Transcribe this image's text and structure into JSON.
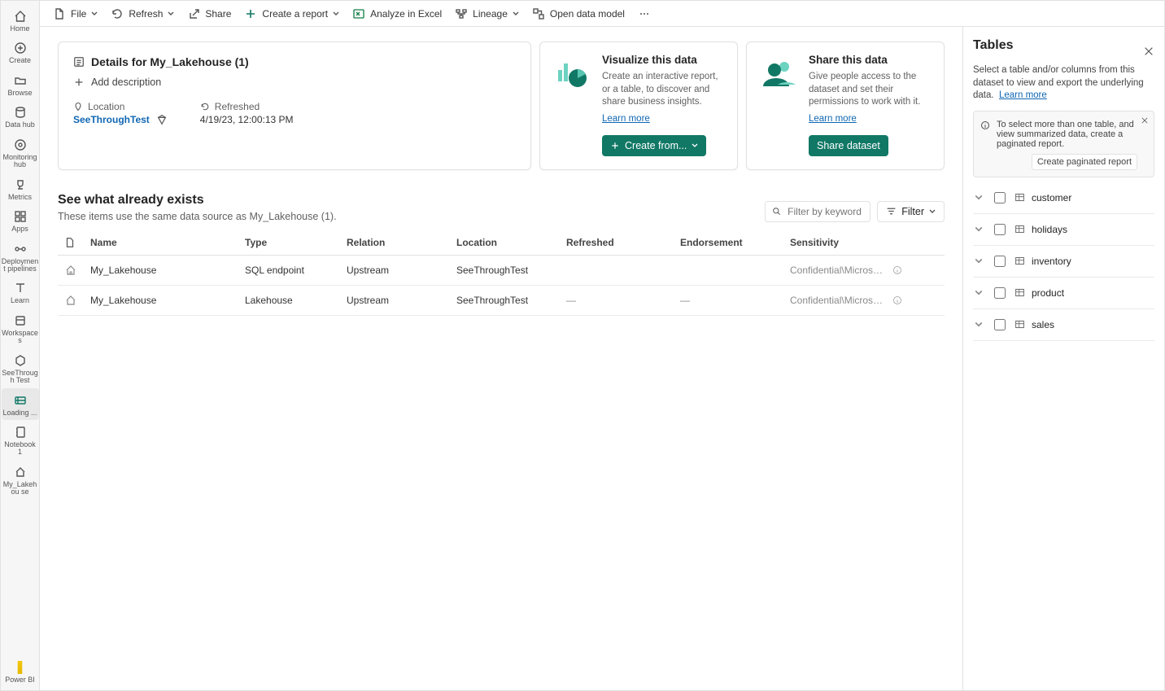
{
  "leftnav": {
    "items": [
      {
        "label": "Home",
        "icon": "home"
      },
      {
        "label": "Create",
        "icon": "plus-circle"
      },
      {
        "label": "Browse",
        "icon": "folder"
      },
      {
        "label": "Data hub",
        "icon": "db"
      },
      {
        "label": "Monitoring hub",
        "icon": "monitor"
      },
      {
        "label": "Metrics",
        "icon": "trophy"
      },
      {
        "label": "Apps",
        "icon": "apps"
      },
      {
        "label": "Deployment pipelines",
        "icon": "pipe"
      },
      {
        "label": "Learn",
        "icon": "book"
      },
      {
        "label": "Workspaces",
        "icon": "ws"
      },
      {
        "label": "SeeThrough Test",
        "icon": "ws2"
      },
      {
        "label": "Loading ...",
        "icon": "loading",
        "selected": true
      },
      {
        "label": "Notebook 1",
        "icon": "nb"
      },
      {
        "label": "My_Lakehou se",
        "icon": "lh"
      }
    ],
    "footer": "Power BI"
  },
  "cmdbar": {
    "file": "File",
    "refresh": "Refresh",
    "share": "Share",
    "create_report": "Create a report",
    "analyze": "Analyze in Excel",
    "lineage": "Lineage",
    "open_dm": "Open data model"
  },
  "details": {
    "title": "Details for My_Lakehouse (1)",
    "add_desc": "Add description",
    "location_label": "Location",
    "location_value": "SeeThroughTest",
    "refreshed_label": "Refreshed",
    "refreshed_value": "4/19/23, 12:00:13 PM"
  },
  "viz_card": {
    "title": "Visualize this data",
    "body": "Create an interactive report, or a table, to discover and share business insights.",
    "learn": "Learn more",
    "button": "Create from..."
  },
  "share_card": {
    "title": "Share this data",
    "body": "Give people access to the dataset and set their permissions to work with it.",
    "learn": "Learn more",
    "button": "Share dataset"
  },
  "existing": {
    "title": "See what already exists",
    "subtitle": "These items use the same data source as My_Lakehouse (1).",
    "filter_placeholder": "Filter by keyword",
    "filter_label": "Filter",
    "columns": {
      "name": "Name",
      "type": "Type",
      "relation": "Relation",
      "location": "Location",
      "refreshed": "Refreshed",
      "endorsement": "Endorsement",
      "sensitivity": "Sensitivity"
    },
    "rows": [
      {
        "name": "My_Lakehouse",
        "type": "SQL endpoint",
        "relation": "Upstream",
        "location": "SeeThroughTest",
        "refreshed": "",
        "endorsement": "",
        "sensitivity": "Confidential\\Microsoft Exten..."
      },
      {
        "name": "My_Lakehouse",
        "type": "Lakehouse",
        "relation": "Upstream",
        "location": "SeeThroughTest",
        "refreshed": "—",
        "endorsement": "—",
        "sensitivity": "Confidential\\Microsoft Exten..."
      }
    ]
  },
  "right": {
    "title": "Tables",
    "desc": "Select a table and/or columns from this dataset to view and export the underlying data.",
    "learn": "Learn more",
    "tip": "To select more than one table, and view summarized data, create a paginated report.",
    "tip_button": "Create paginated report",
    "tables": [
      "customer",
      "holidays",
      "inventory",
      "product",
      "sales"
    ]
  }
}
